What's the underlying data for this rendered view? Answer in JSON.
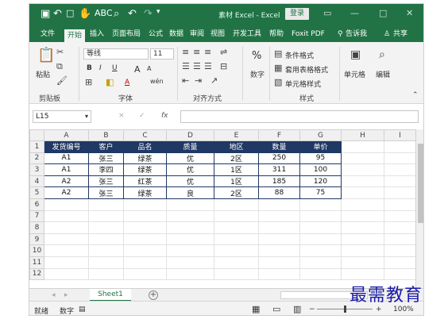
{
  "titlebar": {
    "title": "素材 Excel - Excel",
    "login": "登录",
    "quick_access": [
      "save-icon",
      "undo-icon",
      "new-icon",
      "touch-icon",
      "spell-icon",
      "preview-icon",
      "undo-icon",
      "redo-icon",
      "customize-icon"
    ]
  },
  "menu": {
    "tabs": [
      "文件",
      "开始",
      "插入",
      "页面布局",
      "公式",
      "数据",
      "审阅",
      "视图",
      "开发工具",
      "帮助",
      "Foxit PDF",
      "告诉我",
      "共享"
    ],
    "active": "开始"
  },
  "ribbon": {
    "clipboard": {
      "paste": "粘贴",
      "group": "剪贴板"
    },
    "font": {
      "name": "等线",
      "size": "11",
      "bold": "B",
      "italic": "I",
      "underline": "U",
      "grow": "A",
      "shrink": "A",
      "color_a": "A",
      "wen": "wén",
      "group": "字体"
    },
    "alignment": {
      "group": "对齐方式"
    },
    "number": {
      "percent": "%",
      "label": "数字"
    },
    "styles": {
      "conditional": "条件格式",
      "table": "套用表格格式",
      "cell": "单元格样式",
      "group": "样式"
    },
    "cells": {
      "label": "单元格"
    },
    "editing": {
      "label": "编辑"
    }
  },
  "formula_bar": {
    "name_box": "L15",
    "fx": "fx",
    "cancel": "×",
    "confirm": "✓",
    "formula": ""
  },
  "grid": {
    "columns": [
      "A",
      "B",
      "C",
      "D",
      "E",
      "F",
      "G",
      "H",
      "I"
    ],
    "row_numbers": [
      "1",
      "2",
      "3",
      "4",
      "5",
      "6",
      "7",
      "8",
      "9",
      "10",
      "11",
      "12"
    ],
    "headers": [
      "发货编号",
      "客户",
      "品名",
      "质量",
      "地区",
      "数量",
      "单价"
    ],
    "rows": [
      [
        "A1",
        "张三",
        "绿茶",
        "优",
        "2区",
        "250",
        "95"
      ],
      [
        "A1",
        "李四",
        "绿茶",
        "优",
        "1区",
        "311",
        "100"
      ],
      [
        "A2",
        "张三",
        "红茶",
        "优",
        "1区",
        "185",
        "120"
      ],
      [
        "A2",
        "张三",
        "绿茶",
        "良",
        "2区",
        "88",
        "75"
      ]
    ],
    "header_color": "#1f3864"
  },
  "sheets": {
    "tabs": [
      "Sheet1"
    ],
    "add": "+"
  },
  "status": {
    "ready": "就绪",
    "num": "数字",
    "zoom": "100%"
  },
  "watermark": "最需教育"
}
